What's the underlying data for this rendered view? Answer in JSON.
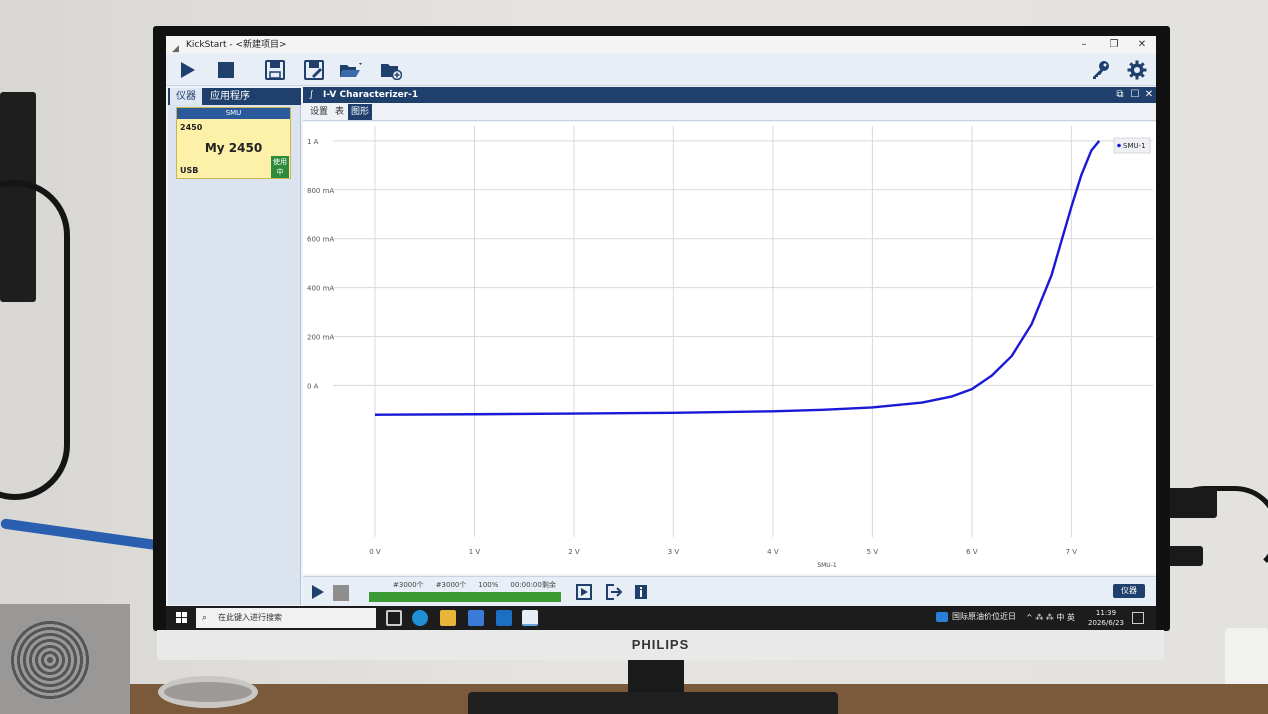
{
  "window": {
    "title": "KickStart - <新建项目>",
    "controls": [
      "–",
      "❐",
      "✕"
    ]
  },
  "toolbar": {
    "icons": [
      "play-icon",
      "stop-icon",
      "save-icon",
      "save-as-icon",
      "open-folder-icon",
      "add-folder-icon",
      "key-icon",
      "gear-icon"
    ]
  },
  "left_panel": {
    "tabs": [
      {
        "label": "仪器",
        "active": true
      },
      {
        "label": "应用程序",
        "active": false
      }
    ],
    "instrument": {
      "header": "SMU",
      "model": "2450",
      "name": "My 2450",
      "connection": "USB",
      "status": "使用中",
      "status_line1": "使用",
      "status_line2": "中"
    }
  },
  "document": {
    "title": "I-V Characterizer-1",
    "controls": [
      "⧉",
      "☐",
      "✕"
    ],
    "tabs": [
      {
        "label": "设置",
        "active": false
      },
      {
        "label": "表",
        "active": false
      },
      {
        "label": "图形",
        "active": true
      }
    ]
  },
  "chart_data": {
    "type": "line",
    "xlabel": "SMU-1",
    "x_unit": "V",
    "y_unit": "A",
    "xlim": [
      -0.02,
      7.7
    ],
    "ylim": [
      -0.62,
      1.02
    ],
    "x_ticks": [
      0,
      1,
      2,
      3,
      4,
      5,
      6,
      7
    ],
    "x_tick_labels": [
      "0 V",
      "1 V",
      "2 V",
      "3 V",
      "4 V",
      "5 V",
      "6 V",
      "7 V"
    ],
    "y_ticks": [
      0,
      0.2,
      0.4,
      0.6,
      0.8,
      1.0
    ],
    "y_tick_labels": [
      "0 A",
      "200 mA",
      "400 mA",
      "600 mA",
      "800 mA",
      "1 A"
    ],
    "grid": true,
    "legend_position": "top-right",
    "series": [
      {
        "name": "SMU-1",
        "color": "#1a1ad6",
        "x": [
          0,
          1,
          2,
          3,
          4,
          4.5,
          5,
          5.5,
          5.8,
          6,
          6.2,
          6.4,
          6.6,
          6.8,
          7,
          7.1,
          7.2,
          7.28
        ],
        "y": [
          -0.12,
          -0.118,
          -0.115,
          -0.112,
          -0.106,
          -0.1,
          -0.09,
          -0.07,
          -0.045,
          -0.015,
          0.04,
          0.12,
          0.25,
          0.45,
          0.73,
          0.86,
          0.96,
          1.0
        ]
      }
    ]
  },
  "run_bar": {
    "points_done": "#3000个",
    "points_total": "#3000个",
    "percent": "100%",
    "remaining": "00:00:00剩余",
    "progress": 1.0,
    "instrument_button": "仪器"
  },
  "taskbar": {
    "search_placeholder": "在此键入进行搜索",
    "news": "国际原油价位近日",
    "tray": "^ ⁂ ⁂ 中 英",
    "time": "11:39",
    "date": "2026/6/23"
  },
  "monitor": {
    "brand": "PHILIPS"
  },
  "colors": {
    "navy": "#1f3f6d",
    "curve": "#1a1ad6",
    "progress": "#3a9a33",
    "instrument_card": "#fdf0a8"
  }
}
